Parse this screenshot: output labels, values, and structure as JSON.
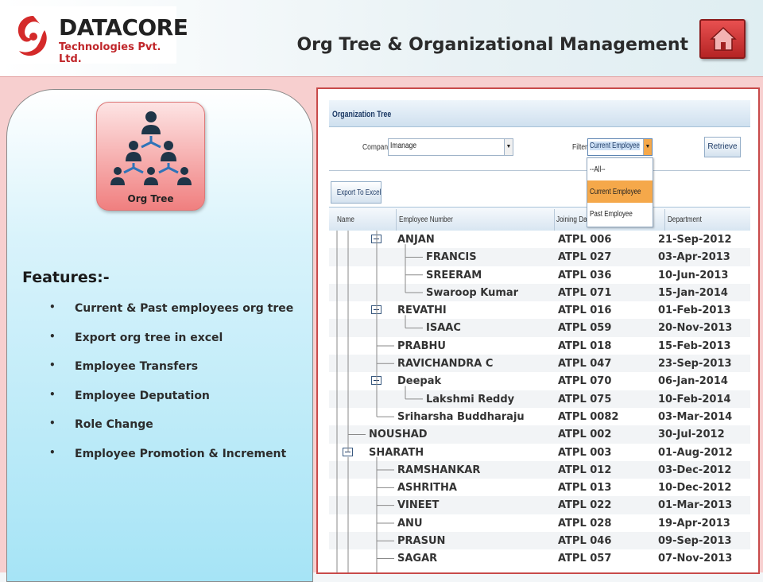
{
  "header": {
    "company_name": "DATACORE",
    "company_sub": "Technologies Pvt. Ltd.",
    "page_title": "Org Tree & Organizational Management"
  },
  "tile": {
    "label": "Org Tree"
  },
  "features": {
    "title": "Features:-",
    "items": [
      "Current & Past employees  org tree",
      "Export org tree in excel",
      "Employee Transfers",
      "Employee Deputation",
      "Role Change",
      "Employee Promotion & Increment"
    ]
  },
  "org_tree": {
    "title": "Organization Tree",
    "company_label": "Company",
    "company_value": "Imanage",
    "filter_label": "Filter",
    "filter_value": "Current Employee",
    "retrieve_label": "Retrieve",
    "export_label": "Export To Excel",
    "filter_options": [
      "--All--",
      "Current Employee",
      "Past Employee"
    ],
    "columns": [
      "Name",
      "Employee Number",
      "Joining Date",
      "Department"
    ],
    "rows": [
      {
        "name": "ANJAN",
        "emp": "ATPL 006",
        "date": "21-Sep-2012",
        "level": 1,
        "expander": true
      },
      {
        "name": "FRANCIS",
        "emp": "ATPL 027",
        "date": "03-Apr-2013",
        "level": 2,
        "expander": false
      },
      {
        "name": "SREERAM",
        "emp": "ATPL 036",
        "date": "10-Jun-2013",
        "level": 2,
        "expander": false
      },
      {
        "name": "Swaroop Kumar",
        "emp": "ATPL 071",
        "date": "15-Jan-2014",
        "level": 2,
        "expander": false
      },
      {
        "name": "REVATHI",
        "emp": "ATPL 016",
        "date": "01-Feb-2013",
        "level": 1,
        "expander": true
      },
      {
        "name": "ISAAC",
        "emp": "ATPL 059",
        "date": "20-Nov-2013",
        "level": 2,
        "expander": false
      },
      {
        "name": "PRABHU",
        "emp": "ATPL 018",
        "date": "15-Feb-2013",
        "level": 1,
        "expander": false
      },
      {
        "name": "RAVICHANDRA C",
        "emp": "ATPL 047",
        "date": "23-Sep-2013",
        "level": 1,
        "expander": false
      },
      {
        "name": "Deepak",
        "emp": "ATPL 070",
        "date": "06-Jan-2014",
        "level": 1,
        "expander": true
      },
      {
        "name": "Lakshmi Reddy",
        "emp": "ATPL 075",
        "date": "10-Feb-2014",
        "level": 2,
        "expander": false
      },
      {
        "name": "Sriharsha Buddharaju",
        "emp": "ATPL 0082",
        "date": "03-Mar-2014",
        "level": 1,
        "expander": false
      },
      {
        "name": "NOUSHAD",
        "emp": "ATPL 002",
        "date": "30-Jul-2012",
        "level": 0,
        "expander": false
      },
      {
        "name": "SHARATH",
        "emp": "ATPL 003",
        "date": "01-Aug-2012",
        "level": 0,
        "expander": true
      },
      {
        "name": "RAMSHANKAR",
        "emp": "ATPL 012",
        "date": "03-Dec-2012",
        "level": 1,
        "expander": false
      },
      {
        "name": "ASHRITHA",
        "emp": "ATPL 013",
        "date": "10-Dec-2012",
        "level": 1,
        "expander": false
      },
      {
        "name": "VINEET",
        "emp": "ATPL 022",
        "date": "01-Mar-2013",
        "level": 1,
        "expander": false
      },
      {
        "name": "ANU",
        "emp": "ATPL 028",
        "date": "19-Apr-2013",
        "level": 1,
        "expander": false
      },
      {
        "name": "PRASUN",
        "emp": "ATPL 046",
        "date": "09-Sep-2013",
        "level": 1,
        "expander": false
      },
      {
        "name": "SAGAR",
        "emp": "ATPL 057",
        "date": "07-Nov-2013",
        "level": 1,
        "expander": false
      }
    ]
  },
  "colors": {
    "accent_red": "#d23a3a",
    "grid_blue": "#1e3b66",
    "dropdown_selected": "#f5a84a"
  },
  "icons": [
    "logo-swirl-icon",
    "home-icon",
    "org-tree-icon",
    "collapse-icon",
    "dropdown-arrow-icon"
  ]
}
